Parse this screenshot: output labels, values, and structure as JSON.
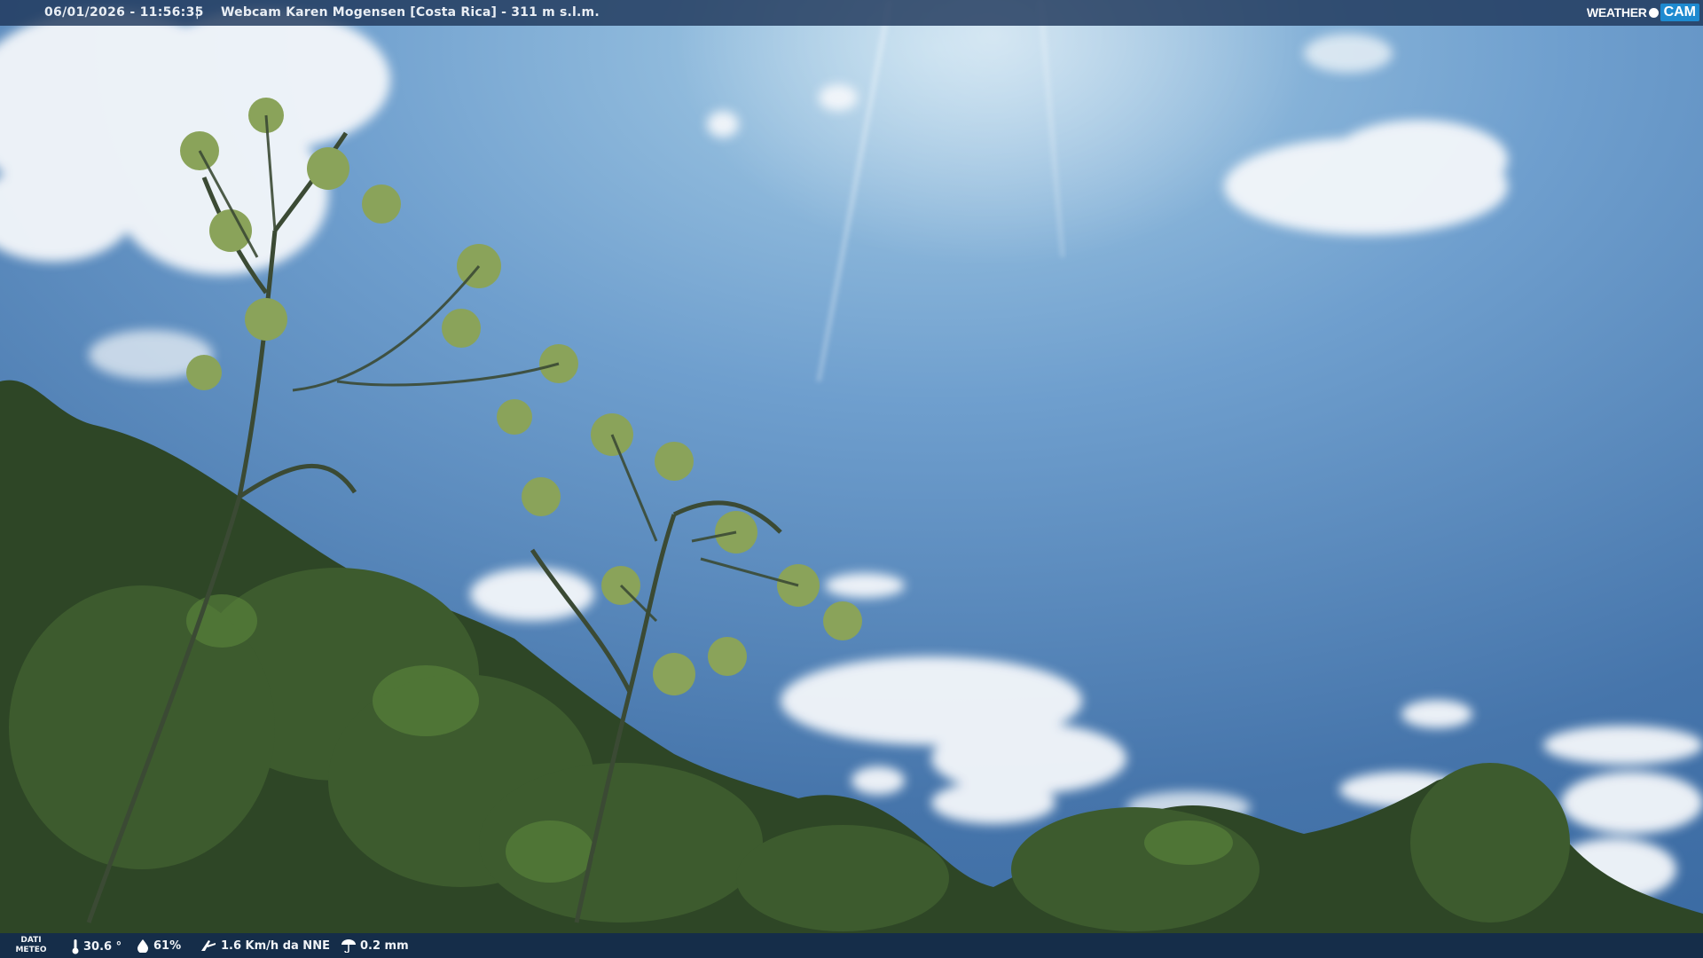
{
  "overlay": {
    "timestamp": "06/01/2026 - 11:56:35",
    "separator": "|",
    "title": "Webcam Karen Mogensen [Costa Rica] - 311 m s.l.m."
  },
  "logo": {
    "weather": "WEATHER",
    "cam": "CAM"
  },
  "weather": {
    "label": "DATI METEO",
    "temperature": "30.6 °",
    "humidity": "61%",
    "wind": "1.6 Km/h da NNE",
    "rain": "0.2 mm"
  },
  "icons": [
    "thermometer-icon",
    "humidity-drop-icon",
    "wind-icon",
    "rain-gauge-icon"
  ],
  "colors": {
    "sky_top": "#9ec6e4",
    "sky_bottom": "#3f6fa6",
    "foliage": "#2d4526",
    "bar": "#1e375a"
  }
}
